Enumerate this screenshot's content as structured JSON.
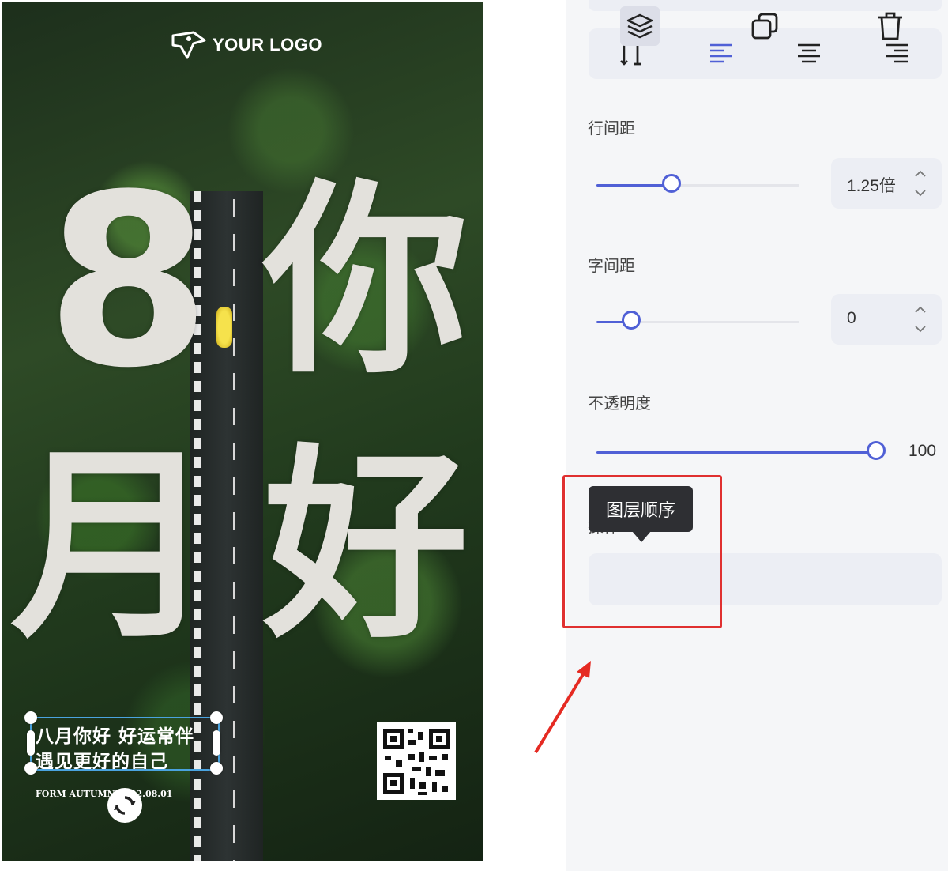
{
  "poster": {
    "logo_text": "YOUR LOGO",
    "big_chars": [
      "8",
      "你",
      "月",
      "好"
    ],
    "slogan_line1": "八月你好  好运常伴",
    "slogan_line2": "遇见更好的自己",
    "footer_text": "FORM AUTUMN     2022.08.01"
  },
  "panel": {
    "alignment_buttons": [
      "vertical-text",
      "align-left",
      "align-center",
      "align-right"
    ],
    "active_alignment": "align-left",
    "line_spacing": {
      "label": "行间距",
      "value": "1.25倍",
      "level": 0.37
    },
    "letter_spacing": {
      "label": "字间距",
      "value": "0",
      "level": 0.17
    },
    "opacity": {
      "label": "不透明度",
      "value": "100",
      "level": 1.0
    },
    "operations": {
      "label": "操作",
      "tooltip": "图层顺序",
      "buttons": [
        "layer-order",
        "duplicate",
        "delete"
      ]
    }
  },
  "colors": {
    "accent": "#5060d6",
    "highlight": "#e03030",
    "tooltip_bg": "#2e2f33"
  }
}
